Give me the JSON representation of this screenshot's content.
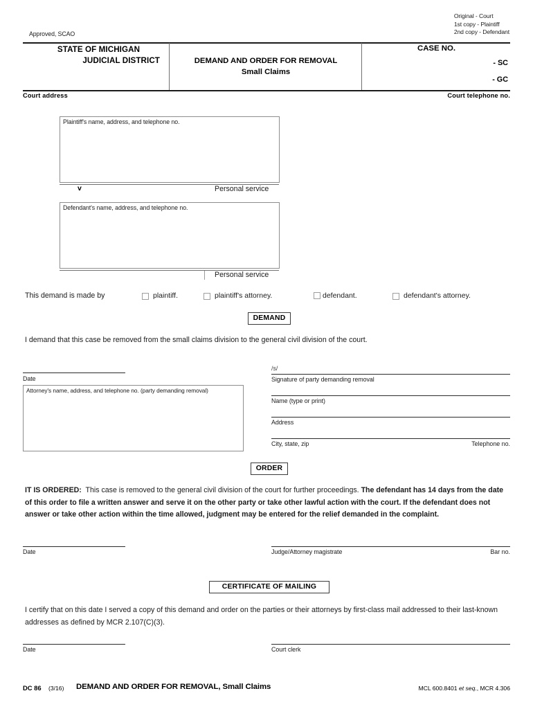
{
  "header": {
    "copies": [
      "Original - Court",
      "1st copy - Plaintiff",
      "2nd copy - Defendant"
    ],
    "approved": "Approved, SCAO",
    "state_line1": "STATE OF MICHIGAN",
    "state_line2": "JUDICIAL DISTRICT",
    "form_title_line1": "DEMAND AND ORDER FOR REMOVAL",
    "form_title_line2": "Small Claims",
    "case_no_label": "CASE NO.",
    "case_suffix_sc": "- SC",
    "case_suffix_gc": "- GC",
    "court_address_label": "Court  address",
    "court_telephone_label": "Court  telephone  no."
  },
  "parties": {
    "plaintiff_caption": "Plaintiff's name, address, and telephone no.",
    "versus": "v",
    "plaintiff_service_label": "Personal service",
    "defendant_caption": "Defendant's name, address, and telephone no.",
    "defendant_service_label": "Personal service"
  },
  "demand_by": {
    "label": "This demand is made by",
    "options": [
      "plaintiff.",
      "plaintiff's attorney.",
      "defendant.",
      "defendant's attorney."
    ]
  },
  "demand": {
    "badge": "DEMAND",
    "statement": "I demand that this case be removed from the small claims division to the general civil division of the court.",
    "date_caption": "Date",
    "attorney_box_caption": "Attorney's name, address, and telephone no. (party demanding removal)",
    "signature_prefix": "/s/",
    "signature_caption": "Signature of party demanding removal",
    "name_caption": "Name (type or print)",
    "address_caption": "Address",
    "city_caption": "City, state, zip",
    "telephone_caption": "Telephone no."
  },
  "order": {
    "badge": "ORDER",
    "lead": "IT IS ORDERED:",
    "body_normal": "This case is removed to the general civil division of the court for further proceedings.",
    "body_bold": "The defendant has 14 days from the date of this order to file a written answer and serve it on the other party or take other lawful action with the court. If the defendant does not answer or take other action within the time allowed, judgment may be entered for the relief demanded in the complaint.",
    "date_caption": "Date",
    "judge_caption": "Judge/Attorney  magistrate",
    "bar_caption": "Bar no."
  },
  "certificate": {
    "badge": "CERTIFICATE OF MAILING",
    "statement": "I certify that on this date I served a copy of this demand and order on the parties or their attorneys by first-class mail addressed to their last-known addresses as defined by MCR 2.107(C)(3).",
    "date_caption": "Date",
    "clerk_caption": "Court clerk"
  },
  "footer": {
    "form_code": "DC 86",
    "revision": "(3/16)",
    "title": "DEMAND AND ORDER FOR REMOVAL, Small Claims",
    "citation_pre": "MCL 600.8401 ",
    "citation_italic": "et seq.",
    "citation_post": ", MCR 4.306"
  }
}
